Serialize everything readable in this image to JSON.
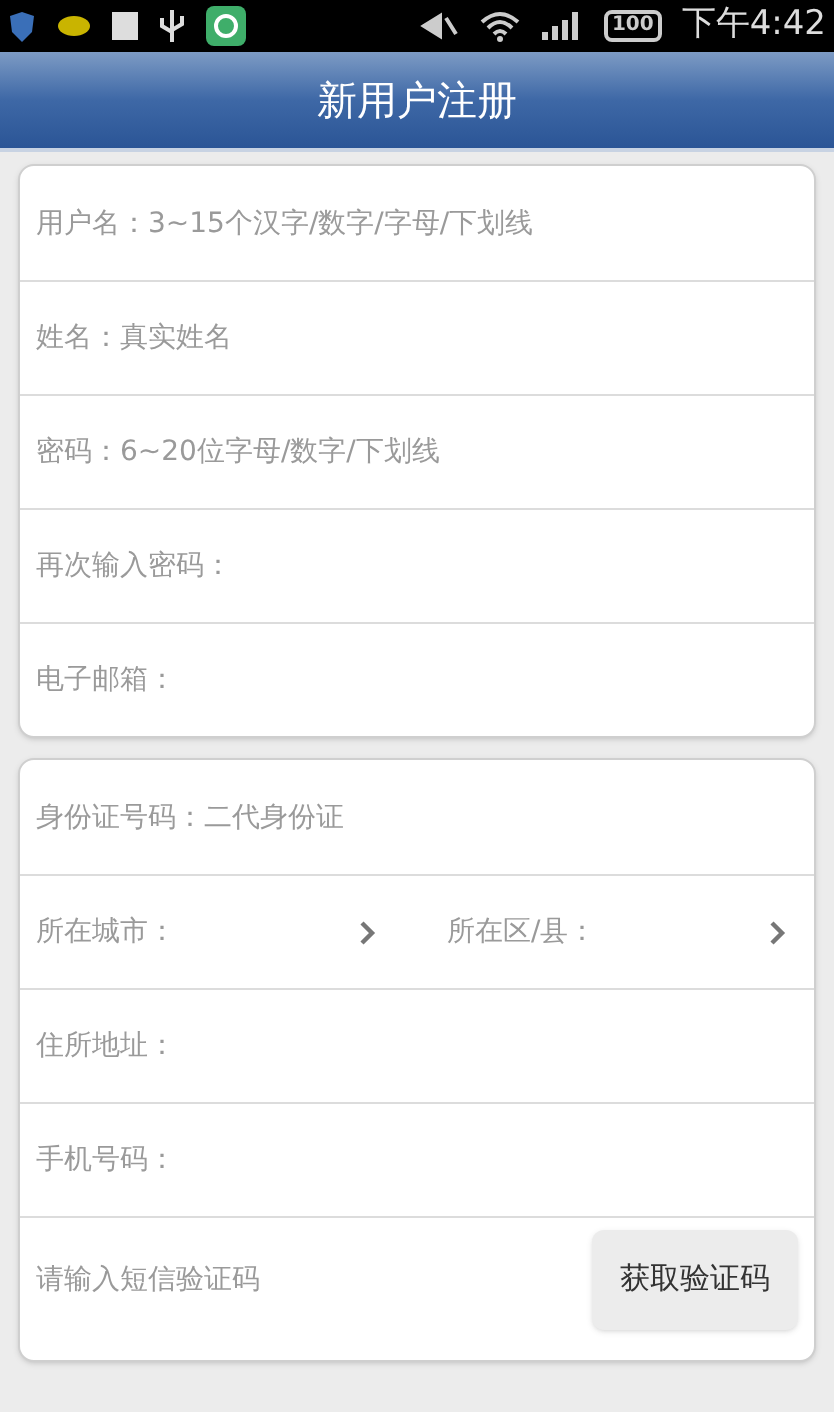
{
  "status_bar": {
    "battery": "100",
    "time": "下午4:42"
  },
  "title": "新用户注册",
  "sections": [
    {
      "rows": [
        {
          "kind": "input",
          "placeholder": "用户名：3~15个汉字/数字/字母/下划线"
        },
        {
          "kind": "input",
          "placeholder": "姓名：真实姓名"
        },
        {
          "kind": "input",
          "placeholder": "密码：6~20位字母/数字/下划线"
        },
        {
          "kind": "input",
          "placeholder": "再次输入密码："
        },
        {
          "kind": "input",
          "placeholder": "电子邮箱："
        }
      ]
    },
    {
      "rows": [
        {
          "kind": "input",
          "placeholder": "身份证号码：二代身份证"
        },
        {
          "kind": "selects",
          "selects": [
            {
              "label": "所在城市："
            },
            {
              "label": "所在区/县："
            }
          ]
        },
        {
          "kind": "input",
          "placeholder": "住所地址："
        },
        {
          "kind": "input",
          "placeholder": "手机号码："
        },
        {
          "kind": "code",
          "placeholder": "请输入短信验证码",
          "button": "获取验证码"
        }
      ]
    }
  ]
}
